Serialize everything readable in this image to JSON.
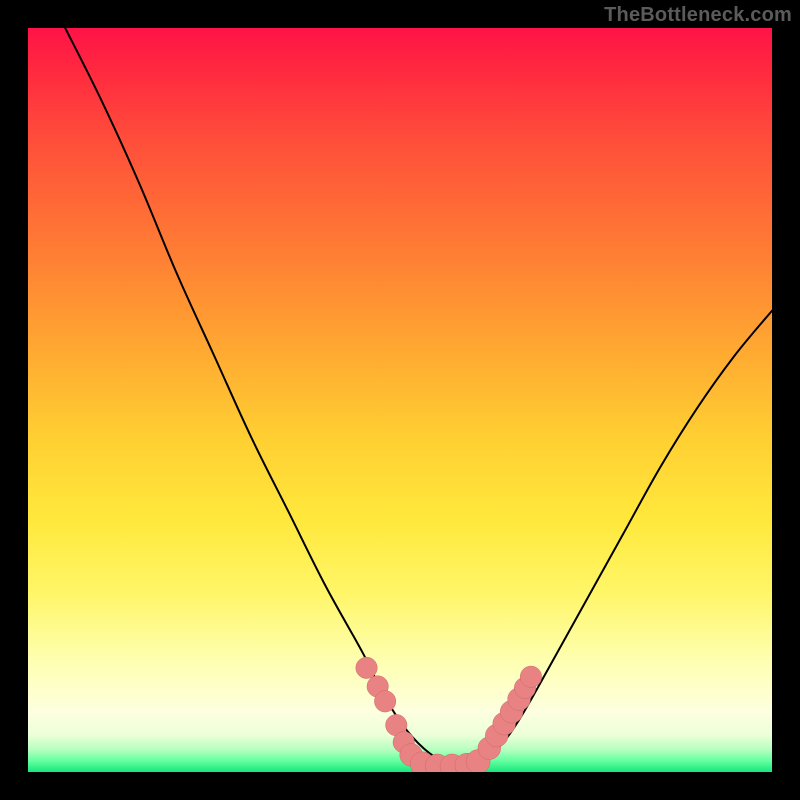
{
  "watermark": "TheBottleneck.com",
  "colors": {
    "page_bg": "#000000",
    "watermark_text": "#5b5b5b",
    "curve_stroke": "#000000",
    "marker_fill": "#e98383",
    "marker_stroke": "#c96a6a",
    "gradient_top": "#ff1347",
    "gradient_bottom": "#18e77c"
  },
  "chart_data": {
    "type": "line",
    "title": "",
    "xlabel": "",
    "ylabel": "",
    "xlim": [
      0,
      100
    ],
    "ylim": [
      0,
      100
    ],
    "grid": false,
    "legend": false,
    "note": "Axes unlabeled; x/y are normalized percent of plot-area width/height. y=0 at bottom (green), y=100 at top (red). Two monotone curves form a V with a flat green trough ~x=50–60; salmon markers cluster around the trough.",
    "series": [
      {
        "name": "left-curve",
        "x": [
          5,
          10,
          15,
          20,
          25,
          30,
          35,
          40,
          45,
          48,
          51,
          54,
          57
        ],
        "y": [
          100,
          90,
          79,
          67,
          56,
          45,
          35,
          25,
          16,
          10,
          5.5,
          2.5,
          0.8
        ]
      },
      {
        "name": "right-curve",
        "x": [
          60,
          63,
          66,
          70,
          75,
          80,
          85,
          90,
          95,
          100
        ],
        "y": [
          0.8,
          3,
          7,
          14,
          23,
          32,
          41,
          49,
          56,
          62
        ]
      },
      {
        "name": "trough",
        "x": [
          52,
          54,
          56,
          58,
          60
        ],
        "y": [
          0.9,
          0.7,
          0.6,
          0.7,
          0.9
        ]
      }
    ],
    "markers": [
      {
        "x": 45.5,
        "y": 14.0,
        "r": 1.0
      },
      {
        "x": 47.0,
        "y": 11.5,
        "r": 1.0
      },
      {
        "x": 48.0,
        "y": 9.5,
        "r": 1.0
      },
      {
        "x": 49.5,
        "y": 6.3,
        "r": 1.0
      },
      {
        "x": 50.5,
        "y": 4.0,
        "r": 1.0
      },
      {
        "x": 51.5,
        "y": 2.3,
        "r": 1.1
      },
      {
        "x": 53.0,
        "y": 1.1,
        "r": 1.2
      },
      {
        "x": 55.0,
        "y": 0.8,
        "r": 1.2
      },
      {
        "x": 57.0,
        "y": 0.8,
        "r": 1.2
      },
      {
        "x": 59.0,
        "y": 0.9,
        "r": 1.2
      },
      {
        "x": 60.5,
        "y": 1.4,
        "r": 1.2
      },
      {
        "x": 62.0,
        "y": 3.2,
        "r": 1.1
      },
      {
        "x": 63.0,
        "y": 4.9,
        "r": 1.1
      },
      {
        "x": 64.0,
        "y": 6.5,
        "r": 1.1
      },
      {
        "x": 65.0,
        "y": 8.1,
        "r": 1.1
      },
      {
        "x": 66.0,
        "y": 9.8,
        "r": 1.1
      },
      {
        "x": 66.8,
        "y": 11.3,
        "r": 1.0
      },
      {
        "x": 67.6,
        "y": 12.8,
        "r": 1.0
      }
    ]
  }
}
